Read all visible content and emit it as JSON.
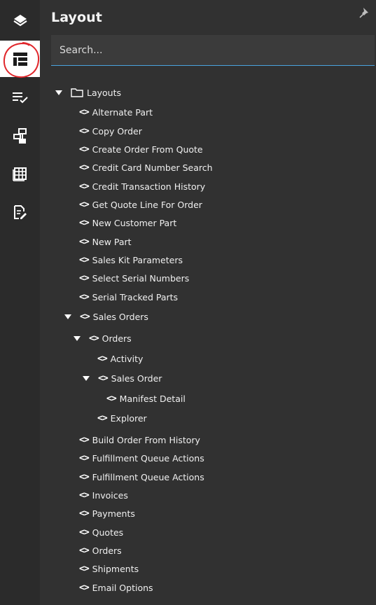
{
  "colors": {
    "rail_bg": "#2b2b2b",
    "panel_bg": "#313131",
    "active_rail_bg": "#ffffff",
    "accent": "#4aa3df",
    "annotation": "#e0262b"
  },
  "rail": {
    "items": [
      {
        "name": "layers-icon",
        "active": false
      },
      {
        "name": "layout-icon",
        "active": true
      },
      {
        "name": "checklist-icon",
        "active": false
      },
      {
        "name": "hierarchy-icon",
        "active": false
      },
      {
        "name": "grid-icon",
        "active": false
      },
      {
        "name": "edit-document-icon",
        "active": false
      }
    ]
  },
  "panel": {
    "title": "Layout",
    "search_placeholder": "Search..."
  },
  "tree": {
    "root": "Layouts",
    "items": [
      {
        "label": "Alternate Part"
      },
      {
        "label": "Copy Order"
      },
      {
        "label": "Create Order From Quote"
      },
      {
        "label": "Credit Card Number Search"
      },
      {
        "label": "Credit Transaction History"
      },
      {
        "label": "Get Quote Line For Order"
      },
      {
        "label": "New Customer Part"
      },
      {
        "label": "New Part"
      },
      {
        "label": "Sales Kit Parameters"
      },
      {
        "label": "Select Serial Numbers"
      },
      {
        "label": "Serial Tracked Parts"
      },
      {
        "label": "Sales Orders"
      },
      {
        "label": "Orders"
      },
      {
        "label": "Activity"
      },
      {
        "label": "Sales Order"
      },
      {
        "label": "Manifest Detail"
      },
      {
        "label": "Explorer"
      },
      {
        "label": "Build Order From History"
      },
      {
        "label": "Fulfillment Queue Actions"
      },
      {
        "label": "Fulfillment Queue Actions"
      },
      {
        "label": "Invoices"
      },
      {
        "label": "Payments"
      },
      {
        "label": "Quotes"
      },
      {
        "label": "Orders"
      },
      {
        "label": "Shipments"
      },
      {
        "label": "Email Options"
      }
    ]
  }
}
